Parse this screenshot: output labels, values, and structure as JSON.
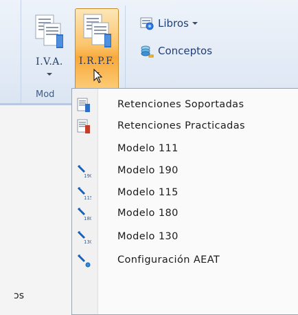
{
  "ribbon": {
    "group_label": "Mod",
    "iva_label": "I.V.A.",
    "irpf_label": "I.R.P.F.",
    "libros_label": "Libros",
    "conceptos_label": "Conceptos"
  },
  "menu": {
    "items": [
      {
        "label": "Retenciones Soportadas",
        "icon": "document-register-icon"
      },
      {
        "label": "Retenciones Practicadas",
        "icon": "document-register-icon"
      },
      {
        "label": "Modelo 111",
        "icon": ""
      },
      {
        "label": "Modelo 190",
        "icon": "modelo-190-icon"
      },
      {
        "label": "Modelo 115",
        "icon": "modelo-115-icon"
      },
      {
        "label": "Modelo 180",
        "icon": "modelo-180-icon"
      },
      {
        "label": "Modelo 130",
        "icon": "modelo-130-icon"
      },
      {
        "label": "Configuración AEAT",
        "icon": "configuration-icon"
      }
    ]
  },
  "page": {
    "fragment_text": "ɔs"
  }
}
